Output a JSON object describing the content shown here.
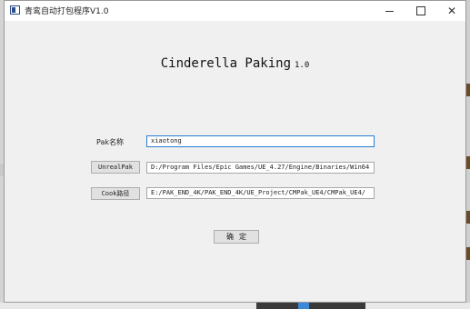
{
  "window": {
    "title": "青鸾自动打包程序V1.0",
    "controls": {
      "minimize": "minimize-icon",
      "maximize": "maximize-icon",
      "close": "✕"
    }
  },
  "header": {
    "title": "Cinderella Paking",
    "version": "1.0"
  },
  "form": {
    "pak_name": {
      "label": "Pak名称",
      "value": "xiaotong"
    },
    "unrealpak": {
      "button_label": "UnrealPak",
      "value": "D:/Program Files/Epic Games/UE_4.27/Engine/Binaries/Win64"
    },
    "cook": {
      "button_label": "Cook路径",
      "value": "E:/PAK_END_4K/PAK_END_4K/UE_Project/CMPak_UE4/CMPak_UE4/"
    },
    "confirm_label": "确定"
  },
  "colors": {
    "window_bg": "#f0f0f0",
    "titlebar_bg": "#ffffff",
    "focus_border": "#2a7bd6",
    "button_bg": "#e1e1e1"
  }
}
